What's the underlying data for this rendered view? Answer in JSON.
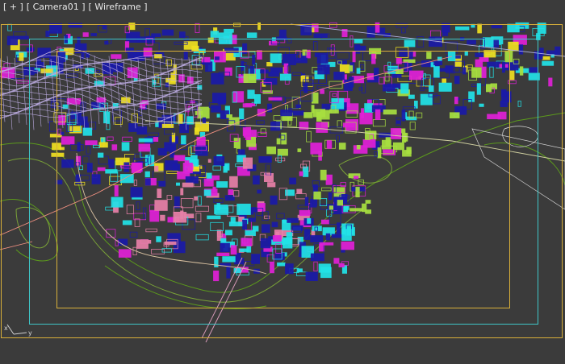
{
  "viewport": {
    "labels": {
      "plus_menu": "[ + ]",
      "camera_name": "[ Camera01 ]",
      "shading_mode": "[ Wireframe ]"
    },
    "axis": {
      "x": "x",
      "y": "y"
    }
  },
  "colors": {
    "background": "#3b3b3b",
    "frame_gold": "#d9b03a",
    "safe_frame_cyan": "#3fc6c8",
    "wire_blue": "#1a1aa8",
    "wire_magenta": "#e020d8",
    "wire_cyan": "#22e3e8",
    "wire_lime": "#a8e040",
    "wire_lilac": "#b8a8dc",
    "wire_green": "#5c9a1c",
    "wire_yellow": "#f0e020",
    "wire_pink": "#e880a8"
  }
}
